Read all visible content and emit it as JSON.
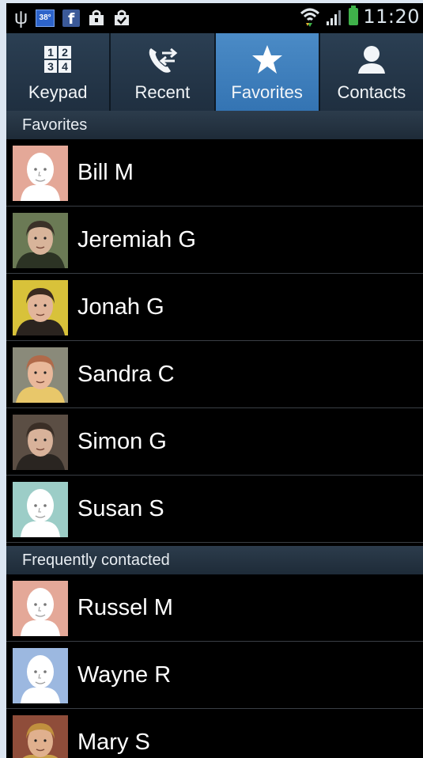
{
  "status_bar": {
    "time": "11:20",
    "temperature_badge": "38°",
    "facebook_glyph": "f",
    "icons": [
      "usb-icon",
      "weather-icon",
      "facebook-icon",
      "shopping-bag-icon",
      "checked-bag-icon",
      "wifi-icon",
      "signal-icon",
      "battery-charging-icon"
    ]
  },
  "tabs": [
    {
      "label": "Keypad",
      "icon": "keypad-icon",
      "active": false
    },
    {
      "label": "Recent",
      "icon": "recent-calls-icon",
      "active": false
    },
    {
      "label": "Favorites",
      "icon": "star-icon",
      "active": true
    },
    {
      "label": "Contacts",
      "icon": "person-icon",
      "active": false
    }
  ],
  "keypad_digits": [
    "1",
    "2",
    "3",
    "4"
  ],
  "sections": {
    "favorites": "Favorites",
    "frequent": "Frequently contacted"
  },
  "favorites": [
    {
      "name": "Bill M",
      "avatar": "default-avatar-pink"
    },
    {
      "name": "Jeremiah G",
      "avatar": "photo-avatar"
    },
    {
      "name": "Jonah G",
      "avatar": "photo-avatar"
    },
    {
      "name": "Sandra C",
      "avatar": "photo-avatar"
    },
    {
      "name": "Simon G",
      "avatar": "photo-avatar"
    },
    {
      "name": "Susan S",
      "avatar": "default-avatar-teal"
    }
  ],
  "frequent": [
    {
      "name": "Russel M",
      "avatar": "default-avatar-pink"
    },
    {
      "name": "Wayne R",
      "avatar": "default-avatar-blue"
    },
    {
      "name": "Mary S",
      "avatar": "photo-avatar"
    }
  ],
  "colors": {
    "active_tab": "#3f80bf",
    "tab_bar": "#263a4d",
    "section_header": "#25354a",
    "avatar_pink": "#e4a898",
    "avatar_teal": "#9ccdc7",
    "avatar_blue": "#9cb8e0"
  }
}
